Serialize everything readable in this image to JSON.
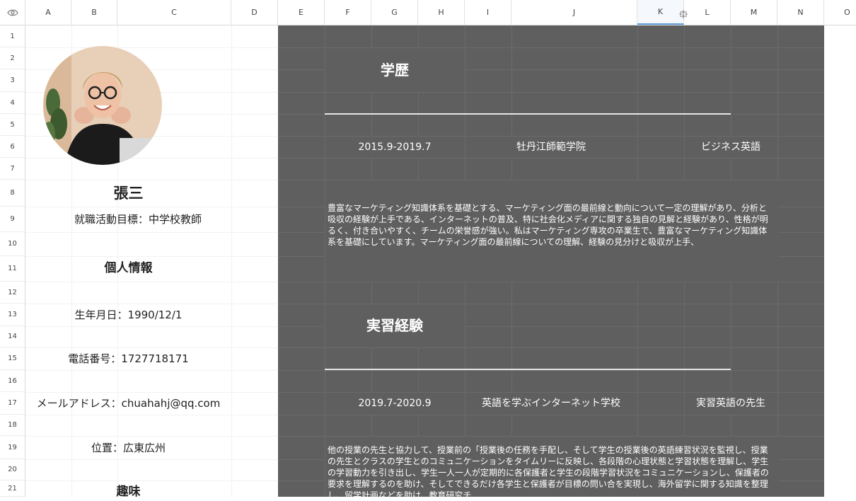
{
  "columns": [
    "A",
    "B",
    "C",
    "D",
    "E",
    "F",
    "G",
    "H",
    "I",
    "J",
    "K",
    "L",
    "M",
    "N",
    "O"
  ],
  "selected_column": "K",
  "rows": [
    "1",
    "2",
    "3",
    "4",
    "5",
    "6",
    "7",
    "8",
    "9",
    "10",
    "11",
    "12",
    "13",
    "14",
    "15",
    "16",
    "17",
    "18",
    "19",
    "20",
    "21"
  ],
  "profile": {
    "name": "張三",
    "objective": "就職活動目標：中学校教師",
    "personal_info_heading": "個人情報",
    "birthday": "生年月日：1990/12/1",
    "phone": "電話番号：1727718171",
    "email": "メールアドレス：chuahahj@qq.com",
    "location": "位置：広東広州",
    "hobbies_heading": "趣味"
  },
  "education": {
    "heading": "学歴",
    "period": "2015.9-2019.7",
    "school": "牡丹江師範学院",
    "major": "ビジネス英語",
    "description": "豊富なマーケティング知識体系を基礎とする、マーケティング面の最前線と動向について一定の理解があり、分析と吸収の経験が上手である、インターネットの普及、特に社会化メディアに関する独自の見解と経験があり、性格が明るく、付き合いやすく、チームの栄誉感が強い。私はマーケティング専攻の卒業生で、豊富なマーケティング知識体系を基礎にしています。マーケティング面の最前線についての理解、経験の見分けと吸収が上手、"
  },
  "internship": {
    "heading": "実習経験",
    "period": "2019.7-2020.9",
    "company": "英語を学ぶインターネット学校",
    "role": "実習英語の先生",
    "description": "他の授業の先生と協力して、授業前の「授業後の任務を手配し、そして学生の授業後の英語練習状況を監視し、授業の先生とクラスの学生とのコミュニケーションをタイムリーに反映し、各段階の心理状態と学習状態を理解し、学生の学習動力を引き出し、学生一人一人が定期的に各保護者と学生の段階学習状況をコミュニケーションし、保護者の要求を理解するのを助け、そしてできるだけ各学生と保護者が目標の問い合を実現し、海外留学に関する知識を整理し、留学計画などを助け、教育研究チ"
  }
}
